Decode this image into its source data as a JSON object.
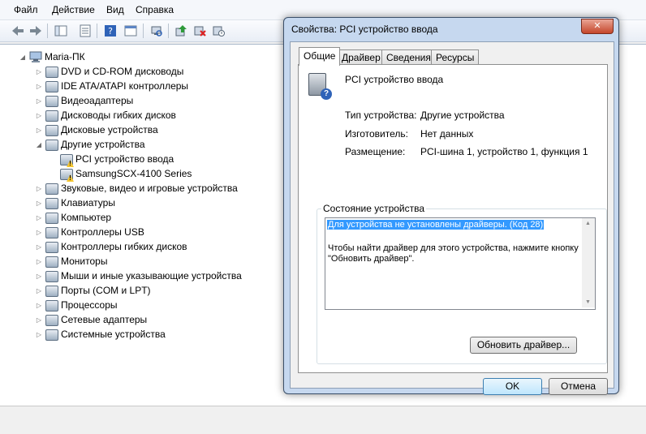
{
  "menu": [
    "Файл",
    "Действие",
    "Вид",
    "Справка"
  ],
  "tree": {
    "root": "Maria-ПК",
    "items": [
      {
        "label": "DVD и CD-ROM дисководы",
        "level": 1,
        "expander": "▷"
      },
      {
        "label": "IDE ATA/ATAPI контроллеры",
        "level": 1,
        "expander": "▷"
      },
      {
        "label": "Видеоадаптеры",
        "level": 1,
        "expander": "▷"
      },
      {
        "label": "Дисководы гибких дисков",
        "level": 1,
        "expander": "▷"
      },
      {
        "label": "Дисковые устройства",
        "level": 1,
        "expander": "▷"
      },
      {
        "label": "Другие устройства",
        "level": 1,
        "expander": "◢"
      },
      {
        "label": "PCI устройство ввода",
        "level": 2,
        "expander": ""
      },
      {
        "label": "SamsungSCX-4100 Series",
        "level": 2,
        "expander": ""
      },
      {
        "label": "Звуковые, видео и игровые устройства",
        "level": 1,
        "expander": "▷"
      },
      {
        "label": "Клавиатуры",
        "level": 1,
        "expander": "▷"
      },
      {
        "label": "Компьютер",
        "level": 1,
        "expander": "▷"
      },
      {
        "label": "Контроллеры USB",
        "level": 1,
        "expander": "▷"
      },
      {
        "label": "Контроллеры гибких дисков",
        "level": 1,
        "expander": "▷"
      },
      {
        "label": "Мониторы",
        "level": 1,
        "expander": "▷"
      },
      {
        "label": "Мыши и иные указывающие устройства",
        "level": 1,
        "expander": "▷"
      },
      {
        "label": "Порты (COM и LPT)",
        "level": 1,
        "expander": "▷"
      },
      {
        "label": "Процессоры",
        "level": 1,
        "expander": "▷"
      },
      {
        "label": "Сетевые адаптеры",
        "level": 1,
        "expander": "▷"
      },
      {
        "label": "Системные устройства",
        "level": 1,
        "expander": "▷"
      }
    ]
  },
  "dialog": {
    "title": "Свойства: PCI устройство ввода",
    "close": "✕",
    "tabs": [
      "Общие",
      "Драйвер",
      "Сведения",
      "Ресурсы"
    ],
    "device_name": "PCI устройство ввода",
    "props": {
      "type_label": "Тип устройства:",
      "type_value": "Другие устройства",
      "mfr_label": "Изготовитель:",
      "mfr_value": "Нет данных",
      "loc_label": "Размещение:",
      "loc_value": "PCI-шина 1, устройство 1, функция 1"
    },
    "status_group": "Состояние устройства",
    "status_line1": "Для устройства не установлены драйверы. (Код 28)",
    "status_line2": "Чтобы найти драйвер для этого устройства, нажмите кнопку \"Обновить драйвер\".",
    "update_button": "Обновить драйвер...",
    "ok": "OK",
    "cancel": "Отмена"
  },
  "colors": {
    "selection": "#3399ff",
    "close": "#c5462b",
    "warning": "#f4c531"
  }
}
